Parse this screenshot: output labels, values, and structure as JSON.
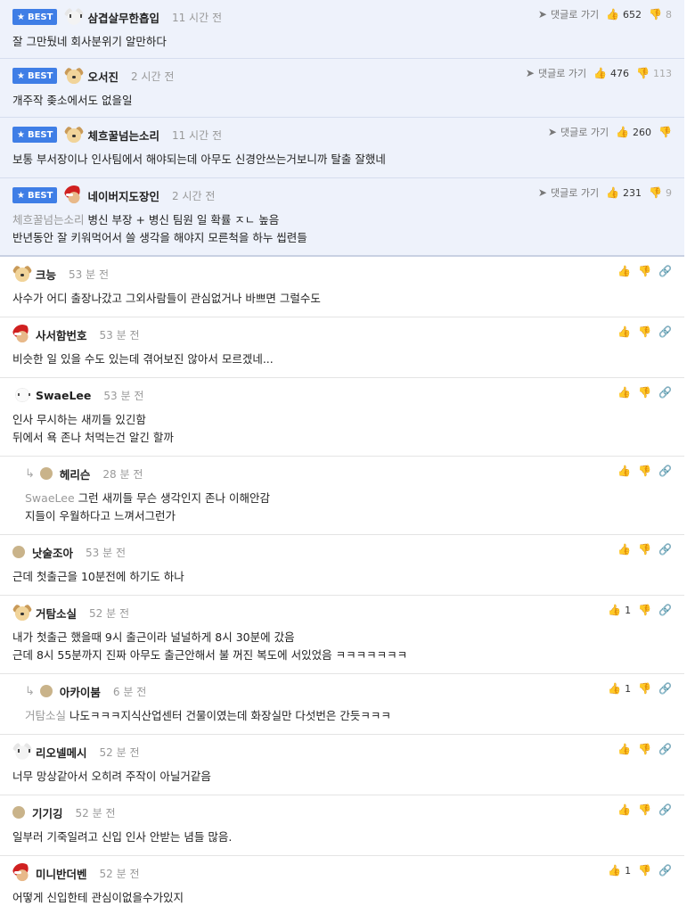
{
  "best_label": "BEST",
  "goto_label": "댓글로 가기",
  "comments": [
    {
      "nick": "삼겹살무한흡입",
      "time": "11 시간 전",
      "up": "652",
      "down": "8",
      "lines": [
        "잘 그만뒀네 회사분위기 알만하다"
      ],
      "mention": "",
      "avatar": "bear-icon"
    },
    {
      "nick": "오서진",
      "time": "2 시간 전",
      "up": "476",
      "down": "113",
      "lines": [
        "개주작 좆소에서도 없을일"
      ],
      "mention": "",
      "avatar": "dog-icon"
    },
    {
      "nick": "체흐꿀넘는소리",
      "time": "11 시간 전",
      "up": "260",
      "down": "",
      "lines": [
        "보통 부서장이나 인사팀에서 해야되는데 아무도 신경안쓰는거보니까 탈출 잘했네"
      ],
      "mention": "",
      "avatar": "dog-icon"
    },
    {
      "nick": "네이버지도장인",
      "time": "2 시간 전",
      "up": "231",
      "down": "9",
      "lines": [
        "병신 부장 + 병신 팀원 일 확률 ㅈㄴ 높음",
        "반년동안 잘 키워먹어서 쓸 생각을 해야지 모른척을 하누 씹련들"
      ],
      "mention": "체흐꿀넘는소리",
      "avatar": "santa-icon"
    },
    {
      "nick": "크능",
      "time": "53 분 전",
      "up": "",
      "down": "",
      "lines": [
        "사수가 어디 출장나갔고 그외사람들이 관심없거나 바쁘면 그럴수도"
      ],
      "mention": "",
      "avatar": "dog-icon"
    },
    {
      "nick": "사서함번호",
      "time": "53 분 전",
      "up": "",
      "down": "",
      "lines": [
        "비슷한 일 있을 수도 있는데 겪어보진 않아서 모르겠네..."
      ],
      "mention": "",
      "avatar": "santa-icon"
    },
    {
      "nick": "SwaeLee",
      "time": "53 분 전",
      "up": "",
      "down": "",
      "lines": [
        "인사 무시하는 새끼들 있긴함",
        "뒤에서 욕 존나 처먹는건 알긴 할까"
      ],
      "mention": "",
      "avatar": "white-dog-icon"
    },
    {
      "nick": "헤리슨",
      "time": "28 분 전",
      "up": "",
      "down": "",
      "lines": [
        "그런 새끼들 무슨 생각인지 존나 이해안감",
        "지들이 우월하다고 느껴서그런가"
      ],
      "mention": "SwaeLee",
      "avatar": "default-avatar-icon"
    },
    {
      "nick": "낫술조아",
      "time": "53 분 전",
      "up": "",
      "down": "",
      "lines": [
        "근데 첫출근을 10분전에 하기도 하나"
      ],
      "mention": "",
      "avatar": "default-avatar-icon"
    },
    {
      "nick": "거탐소실",
      "time": "52 분 전",
      "up": "1",
      "down": "",
      "lines": [
        "내가 첫출근 했을때 9시 출근이라 널널하게 8시 30분에 갔음",
        "근데 8시 55분까지 진짜 아무도 출근안해서 불 꺼진 복도에 서있었음 ㅋㅋㅋㅋㅋㅋㅋ"
      ],
      "mention": "",
      "avatar": "dog-icon"
    },
    {
      "nick": "아카이붐",
      "time": "6 분 전",
      "up": "1",
      "down": "",
      "lines": [
        "나도ㅋㅋㅋ지식산업센터 건물이였는데 화장실만 다섯번은 간듯ㅋㅋㅋ"
      ],
      "mention": "거탐소실",
      "avatar": "default-avatar-icon"
    },
    {
      "nick": "리오넬메시",
      "time": "52 분 전",
      "up": "",
      "down": "",
      "lines": [
        "너무 망상같아서 오히려 주작이 아닐거같음"
      ],
      "mention": "",
      "avatar": "bear-icon"
    },
    {
      "nick": "기기깅",
      "time": "52 분 전",
      "up": "",
      "down": "",
      "lines": [
        "일부러 기죽일려고 신입 인사 안받는 념들 많음."
      ],
      "mention": "",
      "avatar": "default-avatar-icon"
    },
    {
      "nick": "미니반더벤",
      "time": "52 분 전",
      "up": "1",
      "down": "",
      "lines": [
        "어떻게 신입한테 관심이없을수가있지"
      ],
      "mention": "",
      "avatar": "santa-icon"
    }
  ]
}
